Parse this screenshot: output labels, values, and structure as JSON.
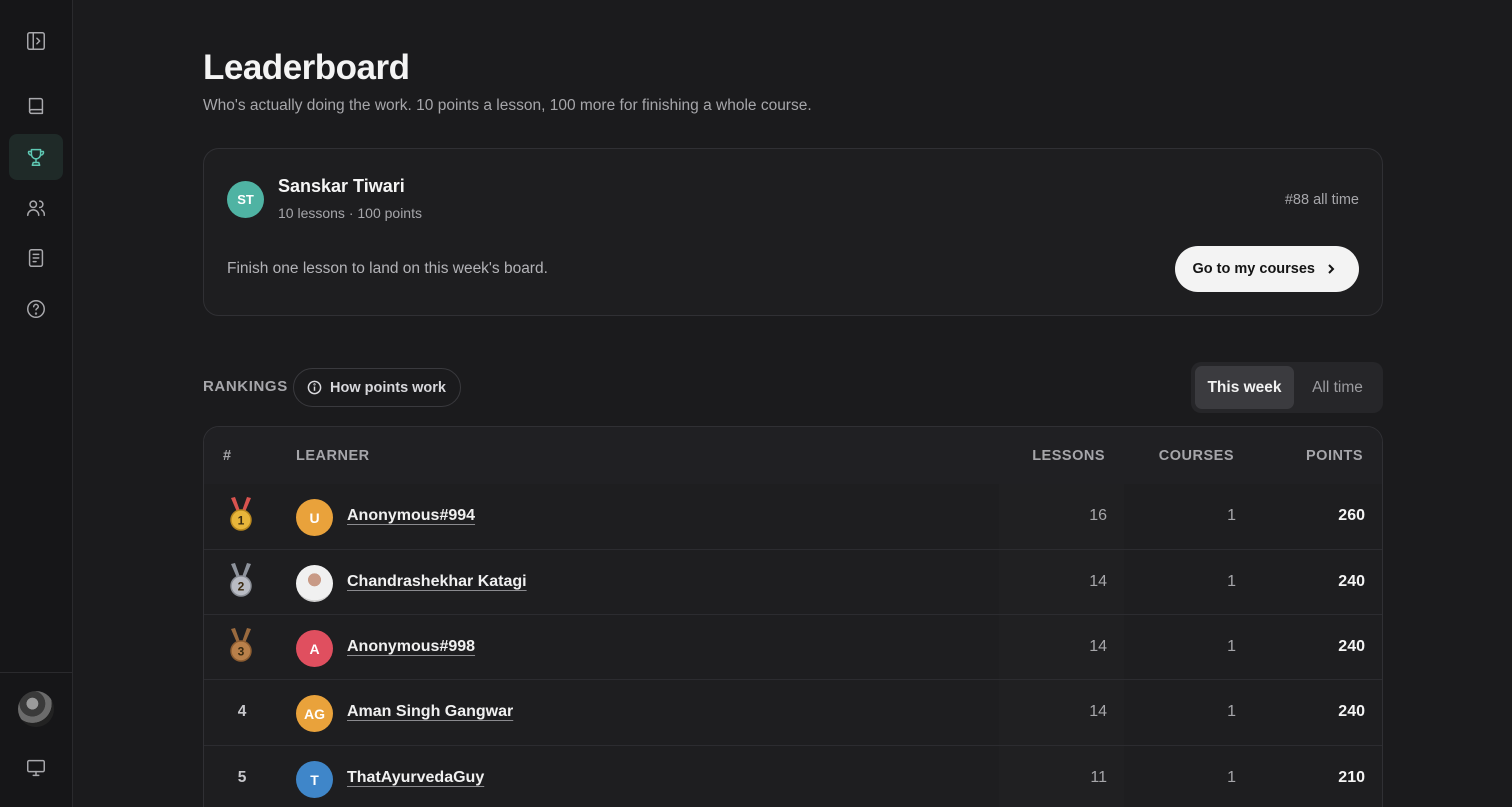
{
  "sidebar": {
    "items": [
      {
        "icon": "sidebar-toggle-icon"
      },
      {
        "icon": "book-icon"
      },
      {
        "icon": "trophy-icon",
        "active": true
      },
      {
        "icon": "users-icon"
      },
      {
        "icon": "document-icon"
      },
      {
        "icon": "help-icon"
      }
    ],
    "bottom": [
      {
        "icon": "avatar"
      },
      {
        "icon": "monitor-icon"
      }
    ]
  },
  "header": {
    "title": "Leaderboard",
    "subtitle": "Who's actually doing the work. 10 points a lesson, 100 more for finishing a whole course."
  },
  "me": {
    "initials": "ST",
    "name": "Sanskar Tiwari",
    "stats": "10 lessons · 100 points",
    "rank": "#88 all time",
    "hint": "Finish one lesson to land on this week's board.",
    "cta_label": "Go to my courses"
  },
  "rankings": {
    "label": "RANKINGS",
    "how_label": "How points work",
    "tabs": [
      "This week",
      "All time"
    ],
    "active_tab": "This week"
  },
  "table": {
    "headers": {
      "rank": "#",
      "learner": "LEARNER",
      "lessons": "LESSONS",
      "courses": "COURSES",
      "points": "POINTS"
    },
    "rows": [
      {
        "rank": "1",
        "medal": "gold",
        "initials": "U",
        "avatar_color": "#e9a23b",
        "name": "Anonymous#994",
        "lessons": "16",
        "courses": "1",
        "points": "260"
      },
      {
        "rank": "2",
        "medal": "silver",
        "initials": "",
        "avatar_color": "photo",
        "name": "Chandrashekhar Katagi",
        "lessons": "14",
        "courses": "1",
        "points": "240"
      },
      {
        "rank": "3",
        "medal": "bronze",
        "initials": "A",
        "avatar_color": "#e04f5f",
        "name": "Anonymous#998",
        "lessons": "14",
        "courses": "1",
        "points": "240"
      },
      {
        "rank": "4",
        "medal": "",
        "initials": "AG",
        "avatar_color": "#e9a23b",
        "name": "Aman Singh Gangwar",
        "lessons": "14",
        "courses": "1",
        "points": "240"
      },
      {
        "rank": "5",
        "medal": "",
        "initials": "T",
        "avatar_color": "#3f86c9",
        "name": "ThatAyurvedaGuy",
        "lessons": "11",
        "courses": "1",
        "points": "210"
      }
    ]
  },
  "colors": {
    "accent": "#5fc9b4",
    "gold": "#e8b53a",
    "silver": "#b9bcc4",
    "bronze": "#b9804a"
  }
}
